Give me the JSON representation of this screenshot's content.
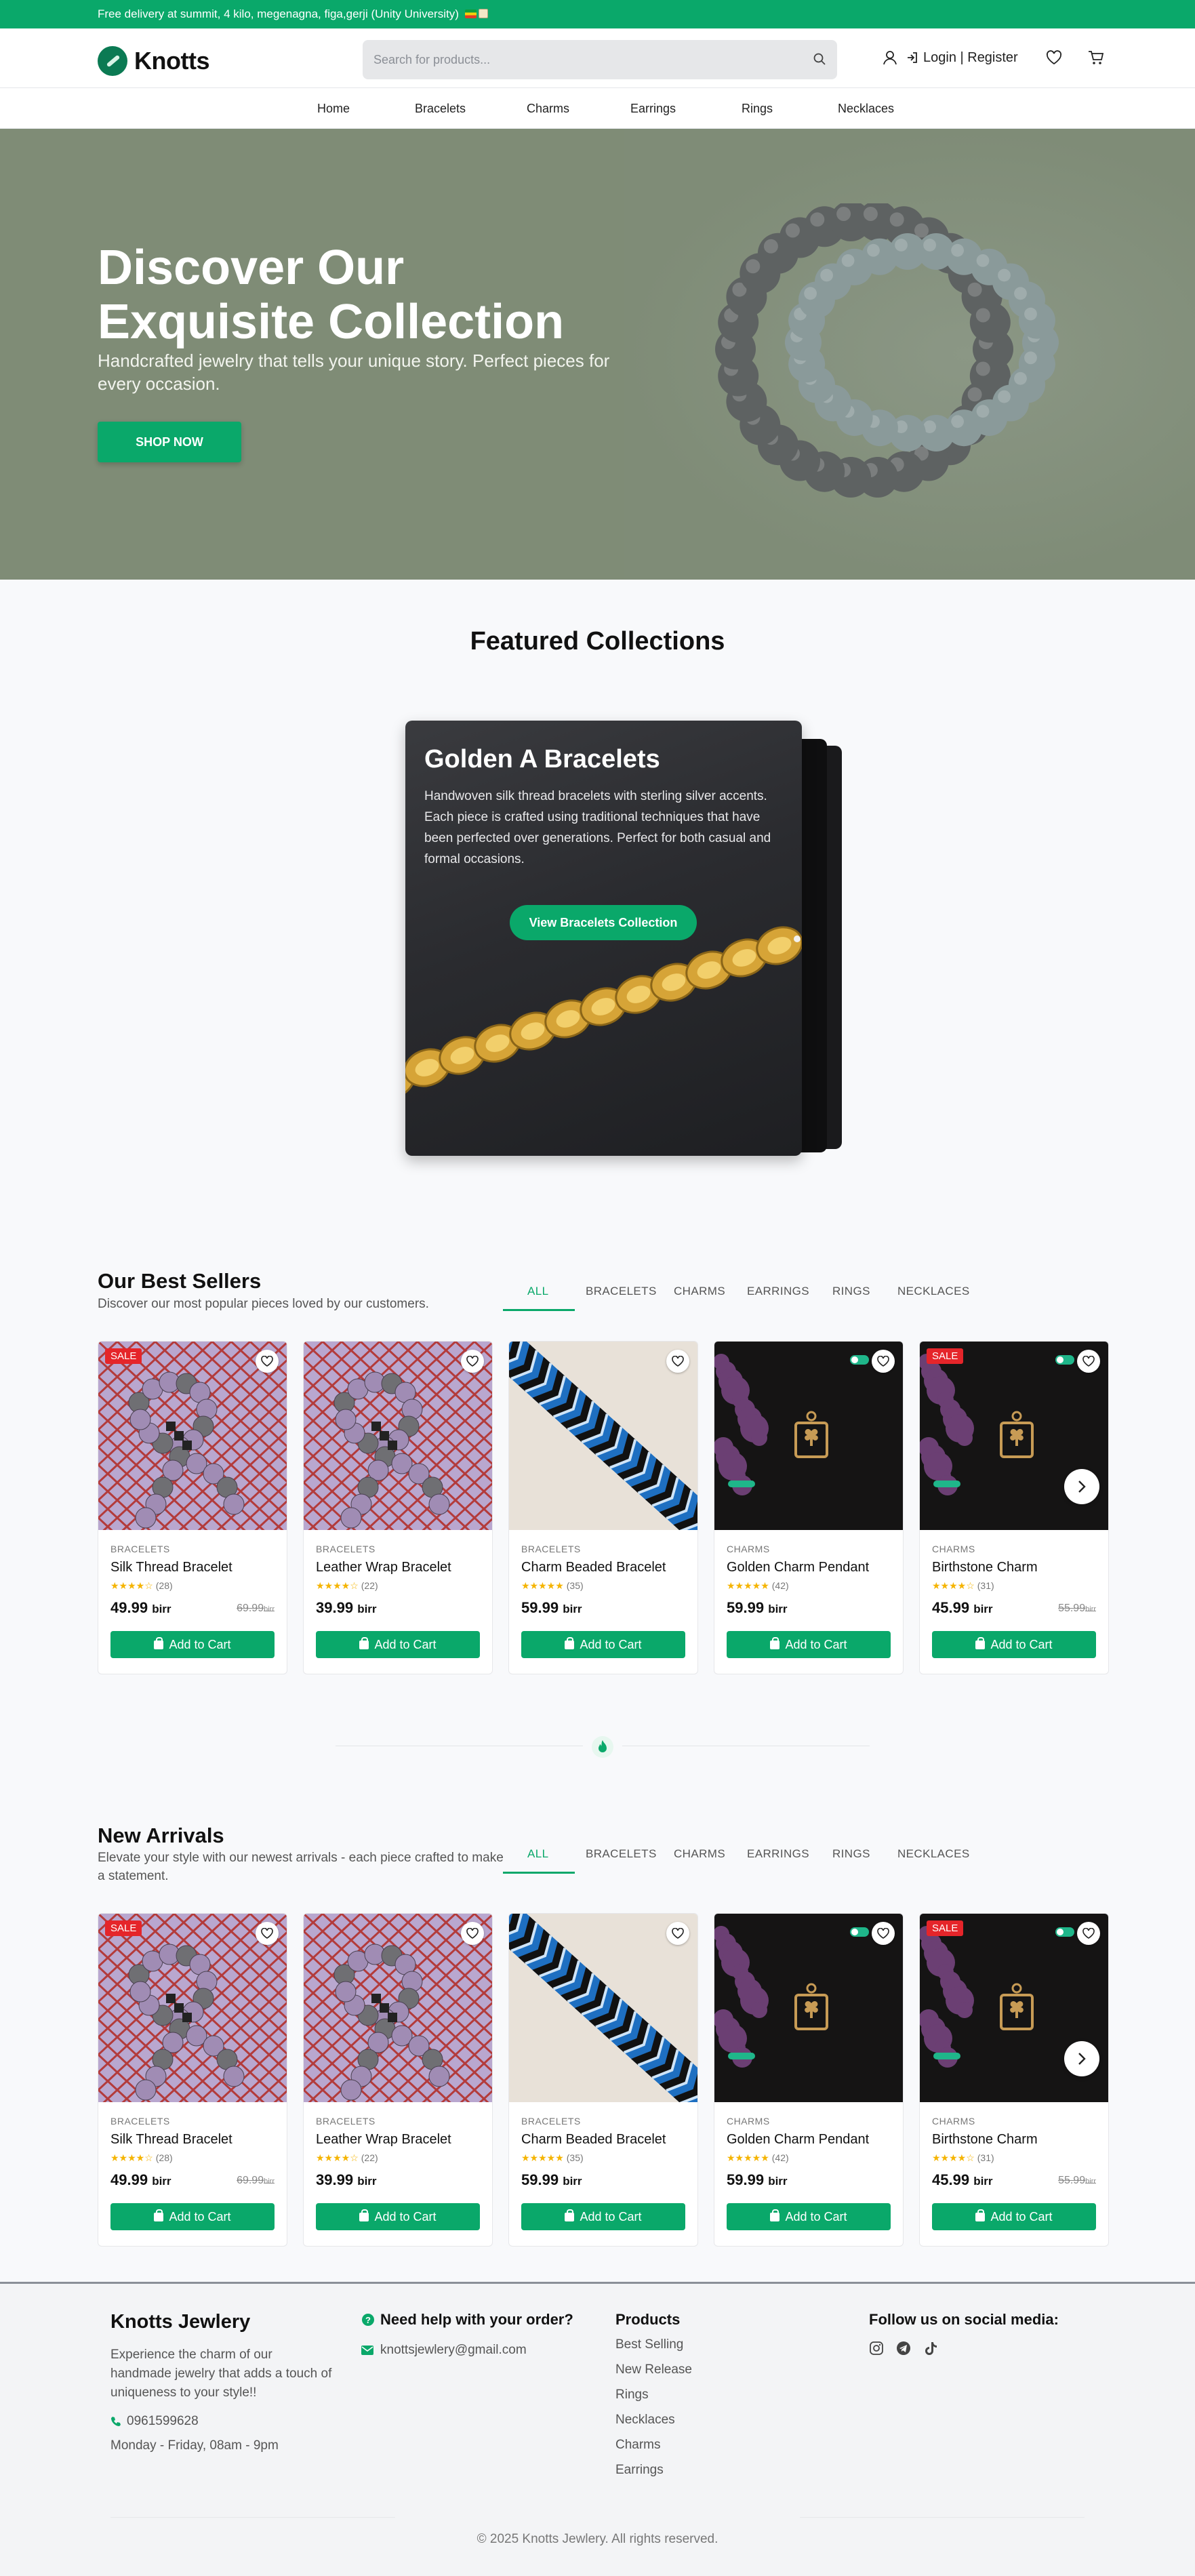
{
  "topbar": {
    "text": "Free delivery at summit, 4 kilo, megenagna, figa,gerji (Unity University)"
  },
  "header": {
    "logo": "Knotts",
    "search_placeholder": "Search for products...",
    "login": "Login | Register"
  },
  "nav": [
    "Home",
    "Bracelets",
    "Charms",
    "Earrings",
    "Rings",
    "Necklaces"
  ],
  "hero": {
    "title": "Discover Our Exquisite Collection",
    "subtitle": "Handcrafted jewelry that tells your unique story. Perfect pieces for every occasion.",
    "cta": "SHOP NOW"
  },
  "featured": {
    "title": "Featured Collections",
    "card_title": "Golden A Bracelets",
    "card_text": "Handwoven silk thread bracelets with sterling silver accents. Each piece is crafted using traditional techniques that have been perfected over generations. Perfect for both casual and formal occasions.",
    "card_button": "View Bracelets Collection"
  },
  "tabs": [
    "ALL",
    "BRACELETS",
    "CHARMS",
    "EARRINGS",
    "RINGS",
    "NECKLACES"
  ],
  "best_sellers": {
    "title": "Our Best Sellers",
    "subtitle": "Discover our most popular pieces loved by our customers."
  },
  "new_arrivals": {
    "title": "New Arrivals",
    "subtitle": "Elevate your style with our newest arrivals - each piece crafted to make a statement."
  },
  "currency": "birr",
  "add_to_cart": "Add to Cart",
  "sale_badge": "SALE",
  "products": [
    {
      "category": "BRACELETS",
      "name": "Silk Thread Bracelet",
      "stars": "★★★★☆",
      "reviews": "(28)",
      "price": "49.99",
      "old_price": "69.99",
      "sale": true,
      "image": "beads"
    },
    {
      "category": "BRACELETS",
      "name": "Leather Wrap Bracelet",
      "stars": "★★★★☆",
      "reviews": "(22)",
      "price": "39.99",
      "old_price": "",
      "sale": false,
      "image": "beads"
    },
    {
      "category": "BRACELETS",
      "name": "Charm Beaded Bracelet",
      "stars": "★★★★★",
      "reviews": "(35)",
      "price": "59.99",
      "old_price": "",
      "sale": false,
      "image": "woven"
    },
    {
      "category": "CHARMS",
      "name": "Golden Charm Pendant",
      "stars": "★★★★★",
      "reviews": "(42)",
      "price": "59.99",
      "old_price": "",
      "sale": false,
      "image": "charm"
    },
    {
      "category": "CHARMS",
      "name": "Birthstone Charm",
      "stars": "★★★★☆",
      "reviews": "(31)",
      "price": "45.99",
      "old_price": "55.99",
      "sale": true,
      "image": "charm"
    }
  ],
  "footer": {
    "brand": "Knotts Jewlery",
    "about": "Experience the charm of our handmade jewelry that adds a touch of uniqueness to your style!!",
    "phone": "0961599628",
    "hours": "Monday - Friday, 08am - 9pm",
    "help_title": "Need help with your order?",
    "email": "knottsjewlery@gmail.com",
    "products_title": "Products",
    "product_links": [
      "Best Selling",
      "New Release",
      "Rings",
      "Necklaces",
      "Charms",
      "Earrings"
    ],
    "social_title": "Follow us on social media:",
    "copyright": "© 2025 Knotts Jewlery. All rights reserved."
  },
  "colors": {
    "brand": "#0aa86a",
    "sale": "#e5252a",
    "hero_bg": "#7f8c76"
  }
}
